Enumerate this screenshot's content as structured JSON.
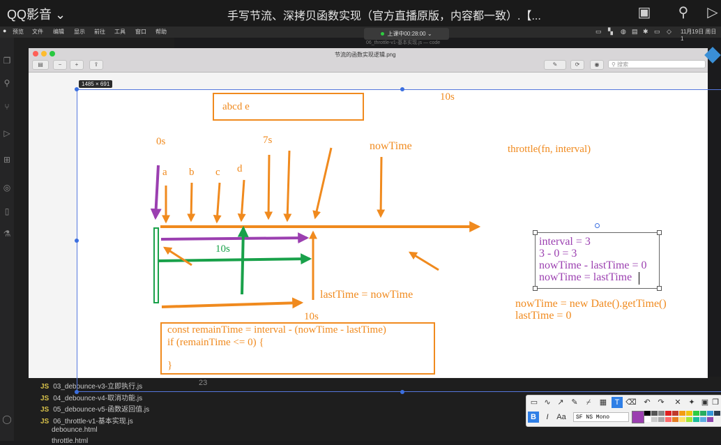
{
  "player": {
    "app_name": "QQ影音",
    "app_chevron": "⌄",
    "video_title": "手写节流、深拷贝函数实现（官方直播原版，内容都一致）.【...",
    "icons": [
      "screenshot-icon",
      "pin-icon",
      "skip-icon"
    ]
  },
  "menubar": {
    "items": [
      "预览",
      "文件",
      "编辑",
      "显示",
      "前往",
      "工具",
      "窗口",
      "帮助"
    ],
    "live_status": "上课中00:28:00",
    "live_chevron": "⌄",
    "vscode_title": "06_throttle-v1-基本实现.js — code",
    "datetime": "11月19日 周日 1"
  },
  "explorer": {
    "files": [
      {
        "badge": "JS",
        "name": "03_debounce-v3-立即执行.js"
      },
      {
        "badge": "JS",
        "name": "04_debounce-v4-取消功能.js"
      },
      {
        "badge": "JS",
        "name": "05_debounce-v5-函数返回值.js"
      },
      {
        "badge": "JS",
        "name": "06_throttle-v1-基本实现.js"
      },
      {
        "badge": "",
        "name": "debounce.html"
      },
      {
        "badge": "",
        "name": "throttle.html"
      }
    ],
    "line_number": "23"
  },
  "preview": {
    "window_title": "节流的函数实现逻辑.png",
    "search_placeholder": "搜索",
    "image_size": "1485 × 691"
  },
  "drawing": {
    "top_box_text": "abcd    e",
    "labels": {
      "t10_top": "10s",
      "t0": "0s",
      "t7": "7s",
      "now_time": "nowTime",
      "signature": "throttle(fn, interval)",
      "a": "a",
      "b": "b",
      "c": "c",
      "d": "d",
      "green_10s": "10s",
      "last_eq_now": "lastTime = nowTime",
      "t10_bottom": "10s"
    },
    "code_lines": [
      "const remainTime = interval - (nowTime - lastTime)",
      "if (remainTime <= 0) {",
      "",
      "}"
    ],
    "note_lines": [
      "interval = 3",
      "3 - 0 = 3",
      "nowTime - lastTime = 0",
      "nowTime = lastTime"
    ],
    "bottom_lines": [
      "nowTime = new Date().getTime()",
      "lastTime = 0"
    ],
    "colors": {
      "orange": "#f08a1e",
      "purple": "#9b3fb0",
      "green": "#19a14a"
    }
  },
  "annotation_toolbar": {
    "font": "SF NS Mono",
    "bold": "B",
    "italic": "I",
    "tools": [
      "select-icon",
      "curve-icon",
      "arrow-icon",
      "pen-icon",
      "highlighter-icon",
      "mosaic-icon",
      "text-icon",
      "eraser-icon",
      "undo-icon",
      "redo-icon",
      "close-icon",
      "pin-icon",
      "save-icon",
      "copy-icon"
    ],
    "palette": [
      "#9b3fb0",
      "#000000",
      "#555555",
      "#888888",
      "#e02020",
      "#c0392b",
      "#f39c12",
      "#f1c40f",
      "#2ecc40",
      "#27ae60",
      "#3498db",
      "#2c3e50",
      "#ffffff",
      "#cccccc",
      "#aaaaaa",
      "#ff6b6b",
      "#e67e22",
      "#ffe066",
      "#a3e635",
      "#1abc9c",
      "#5dade2",
      "#8e44ad"
    ]
  }
}
